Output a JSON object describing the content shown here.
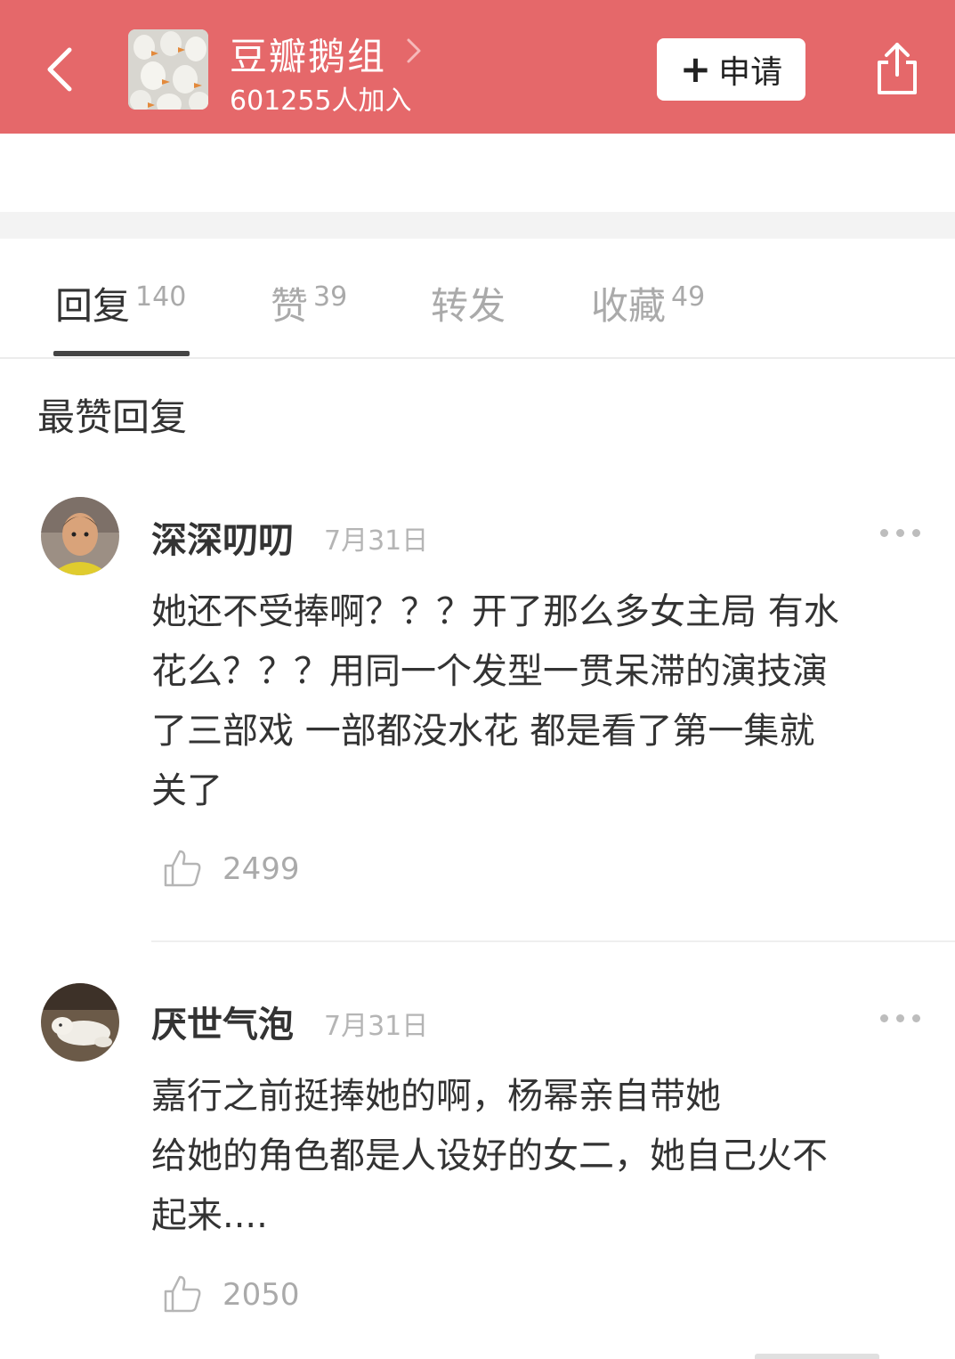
{
  "header": {
    "group_name": "豆瓣鹅组",
    "member_count": "601255人加入",
    "apply_label": "申请",
    "background_color": "#e5686a"
  },
  "tabs": [
    {
      "label": "回复",
      "count": "140",
      "active": true
    },
    {
      "label": "赞",
      "count": "39",
      "active": false
    },
    {
      "label": "转发",
      "count": "",
      "active": false
    },
    {
      "label": "收藏",
      "count": "49",
      "active": false
    }
  ],
  "section": {
    "title": "最赞回复"
  },
  "comments": [
    {
      "username": "深深叨叨",
      "date": "7月31日",
      "text": "她还不受捧啊？？？开了那么多女主局 有水\n花么？？？用同一个发型一贯呆滞的演技演\n了三部戏 一部都没水花   都是看了第一集就\n关了",
      "likes": "2499"
    },
    {
      "username": "厌世气泡",
      "date": "7月31日",
      "text": "嘉行之前挺捧她的啊，杨幂亲自带她\n给她的角色都是人设好的女二，她自己火不\n起来....",
      "likes": "2050"
    }
  ]
}
